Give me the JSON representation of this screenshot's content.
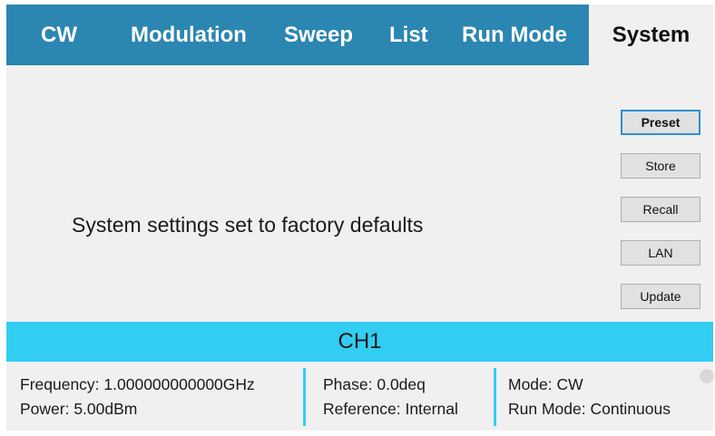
{
  "tabs": {
    "cw": "CW",
    "modulation": "Modulation",
    "sweep": "Sweep",
    "list": "List",
    "run_mode": "Run Mode",
    "system": "System"
  },
  "main": {
    "message": "System settings set to factory defaults"
  },
  "buttons": {
    "preset": "Preset",
    "store": "Store",
    "recall": "Recall",
    "lan": "LAN",
    "update": "Update"
  },
  "channel": {
    "name": "CH1",
    "frequency": "Frequency: 1.000000000000GHz",
    "power": "Power: 5.00dBm",
    "phase": "Phase: 0.0deq",
    "reference": "Reference: Internal",
    "mode": "Mode: CW",
    "run_mode": "Run Mode: Continuous"
  },
  "colors": {
    "tab_bar": "#2b86b1",
    "channel_bar": "#33cdf2",
    "default_button_border": "#2e8fd0"
  }
}
